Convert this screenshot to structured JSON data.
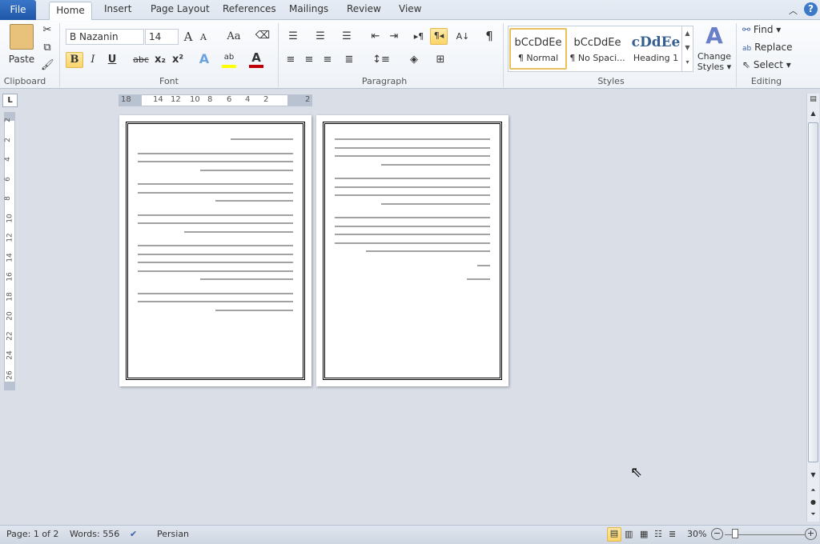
{
  "tabs": {
    "file": "File",
    "items": [
      "Home",
      "Insert",
      "Page Layout",
      "References",
      "Mailings",
      "Review",
      "View"
    ]
  },
  "clipboard": {
    "paste": "Paste",
    "label": "Clipboard"
  },
  "font": {
    "name": "B Nazanin",
    "size": "14",
    "label": "Font",
    "bold": "B",
    "italic": "I",
    "underline": "U",
    "strike": "abc",
    "sub": "x₂",
    "sup": "x²",
    "grow": "A",
    "shrink": "A",
    "case": "Aa",
    "color_accent": "#c00000",
    "highlight": "#ffff00"
  },
  "paragraph": {
    "label": "Paragraph",
    "rtl": "¶◂",
    "ltr": "▸¶",
    "sort": "A↓",
    "show": "¶"
  },
  "styles": {
    "label": "Styles",
    "items": [
      {
        "sample": "bCcDdEe",
        "name": "¶ Normal"
      },
      {
        "sample": "bCcDdEe",
        "name": "¶ No Spaci..."
      },
      {
        "sample": "cDdEe",
        "name": "Heading 1"
      }
    ],
    "change": "Change",
    "change2": "Styles"
  },
  "editing": {
    "label": "Editing",
    "find": "Find",
    "replace": "Replace",
    "select": "Select"
  },
  "ruler": {
    "h": [
      "18",
      "14",
      "12",
      "10",
      "8",
      "6",
      "4",
      "2",
      "2"
    ],
    "v": [
      "2",
      "2",
      "4",
      "6",
      "8",
      "10",
      "12",
      "14",
      "16",
      "18",
      "20",
      "22",
      "24",
      "26"
    ]
  },
  "status": {
    "page": "Page: 1 of 2",
    "words": "Words: 556",
    "language": "Persian",
    "zoom": "30%"
  }
}
